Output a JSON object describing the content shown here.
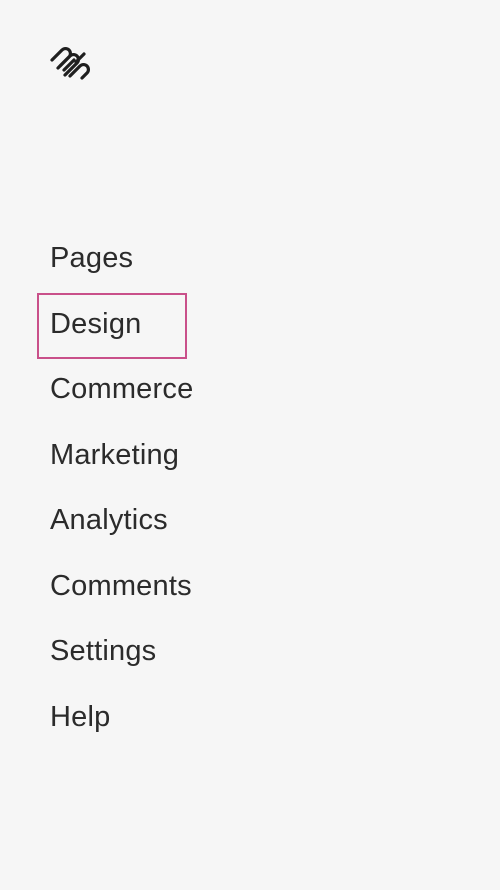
{
  "app": {
    "logo_icon": "squarespace-logo-icon"
  },
  "nav": {
    "items": [
      {
        "label": "Pages"
      },
      {
        "label": "Design"
      },
      {
        "label": "Commerce"
      },
      {
        "label": "Marketing"
      },
      {
        "label": "Analytics"
      },
      {
        "label": "Comments"
      },
      {
        "label": "Settings"
      },
      {
        "label": "Help"
      }
    ],
    "highlighted_item": "Design",
    "highlight_color": "#c9508a"
  },
  "colors": {
    "background": "#f6f6f6",
    "text": "#2b2b2b"
  }
}
